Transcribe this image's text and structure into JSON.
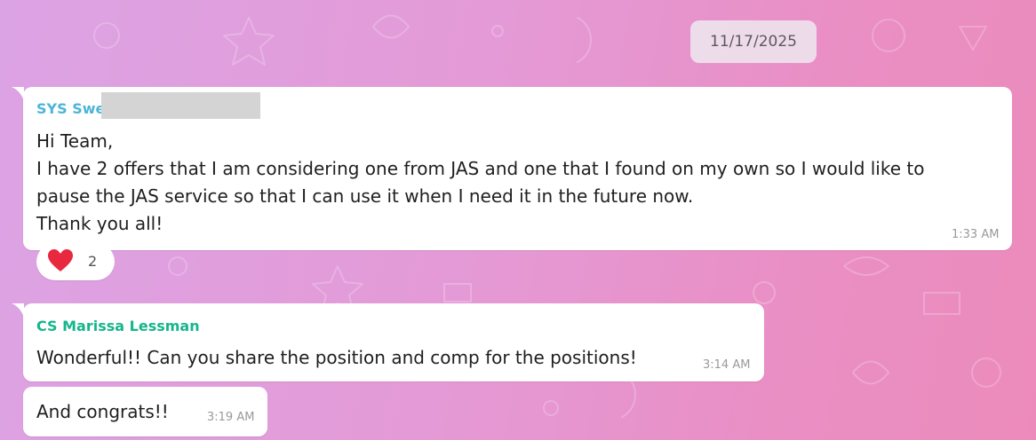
{
  "date_chip": "11/17/2025",
  "messages": [
    {
      "sender": "SYS Swe",
      "sender_color": "#4db5d6",
      "text": "Hi Team,\nI have 2 offers that I am considering one from JAS and one that I found on my own so I would like to\npause the JAS service so that I can use it when I need it in the future now.\nThank you all!",
      "time": "1:33 AM",
      "reaction": {
        "emoji": "heart-icon",
        "count": "2"
      }
    },
    {
      "sender": "CS Marissa Lessman",
      "sender_color": "#16b58c",
      "text": "Wonderful!! Can you share the position and comp for the positions!",
      "time": "3:14 AM"
    },
    {
      "text": "And congrats!!",
      "time": "3:19 AM"
    }
  ],
  "colors": {
    "background_start": "#dca3e4",
    "background_end": "#ec8bbb",
    "bubble": "#ffffff",
    "heart": "#e8283f"
  }
}
